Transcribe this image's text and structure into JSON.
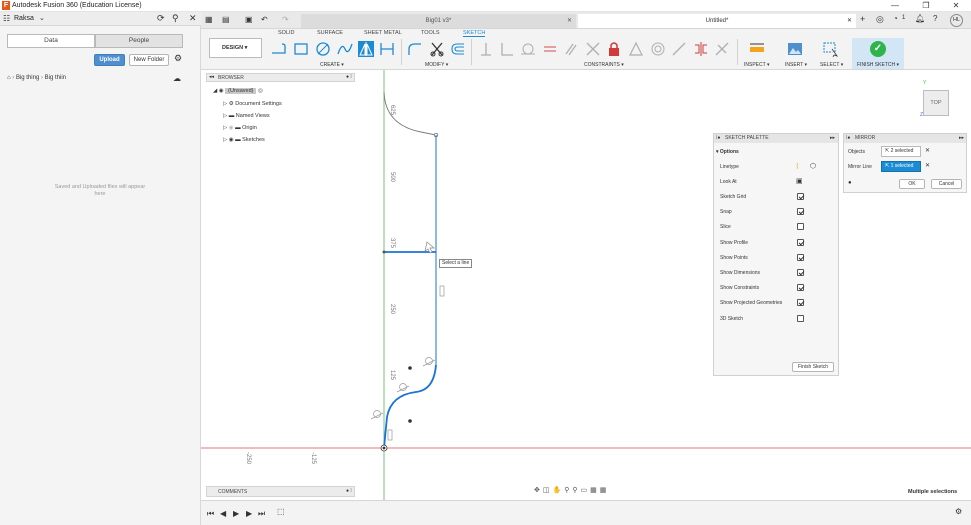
{
  "window": {
    "title": "Autodesk Fusion 360 (Education License)",
    "controls": [
      "—",
      "❐",
      "✕"
    ]
  },
  "data_panel": {
    "team": "Raksa",
    "tabs": [
      "Data",
      "People"
    ],
    "upload_label": "Upload",
    "new_folder_label": "New Folder",
    "breadcrumb": [
      "Big thing",
      "Big thiin"
    ],
    "empty_message": "Saved and Uploaded files will appear here"
  },
  "doc_tabs": [
    {
      "label": "Big01 v3*",
      "active": false
    },
    {
      "label": "Untitled*",
      "active": true
    }
  ],
  "user_initials": "HL",
  "notification_count": "1",
  "workspace": {
    "name": "DESIGN",
    "tabs": [
      "SOLID",
      "SURFACE",
      "SHEET METAL",
      "TOOLS",
      "SKETCH"
    ],
    "active_tab": "SKETCH",
    "groups": [
      "CREATE",
      "MODIFY",
      "CONSTRAINTS",
      "INSPECT",
      "INSERT",
      "SELECT",
      "FINISH SKETCH"
    ]
  },
  "browser": {
    "title": "BROWSER",
    "root": "(Unsaved)",
    "items": [
      "Document Settings",
      "Named Views",
      "Origin",
      "Sketches"
    ]
  },
  "canvas": {
    "tooltip": "Select a line",
    "dim_labels_vertical": [
      "625",
      "500",
      "375",
      "250",
      "125"
    ],
    "dim_labels_horizontal": [
      "-250",
      "-125"
    ],
    "viewcube_label": "TOP",
    "status": "Multiple selections"
  },
  "sketch_palette": {
    "title": "SKETCH PALETTE",
    "section": "Options",
    "rows": [
      {
        "label": "Linetype",
        "checked": null
      },
      {
        "label": "Look At",
        "checked": null
      },
      {
        "label": "Sketch Grid",
        "checked": true
      },
      {
        "label": "Snap",
        "checked": true
      },
      {
        "label": "Slice",
        "checked": false
      },
      {
        "label": "Show Profile",
        "checked": true
      },
      {
        "label": "Show Points",
        "checked": true
      },
      {
        "label": "Show Dimensions",
        "checked": true
      },
      {
        "label": "Show Constraints",
        "checked": true
      },
      {
        "label": "Show Projected Geometries",
        "checked": true
      },
      {
        "label": "3D Sketch",
        "checked": false
      }
    ],
    "finish_label": "Finish Sketch"
  },
  "mirror_dialog": {
    "title": "MIRROR",
    "objects_label": "Objects",
    "objects_value": "2 selected",
    "mirror_line_label": "Mirror Line",
    "mirror_line_value": "1 selected",
    "ok_label": "OK",
    "cancel_label": "Cancel"
  },
  "comments": {
    "title": "COMMENTS"
  },
  "colors": {
    "accent": "#1b8bd4",
    "finish_sketch": "#2fb34a",
    "sketch_line": "#1a73d6",
    "axis_x": "#e04848",
    "axis_y": "#54b854"
  }
}
